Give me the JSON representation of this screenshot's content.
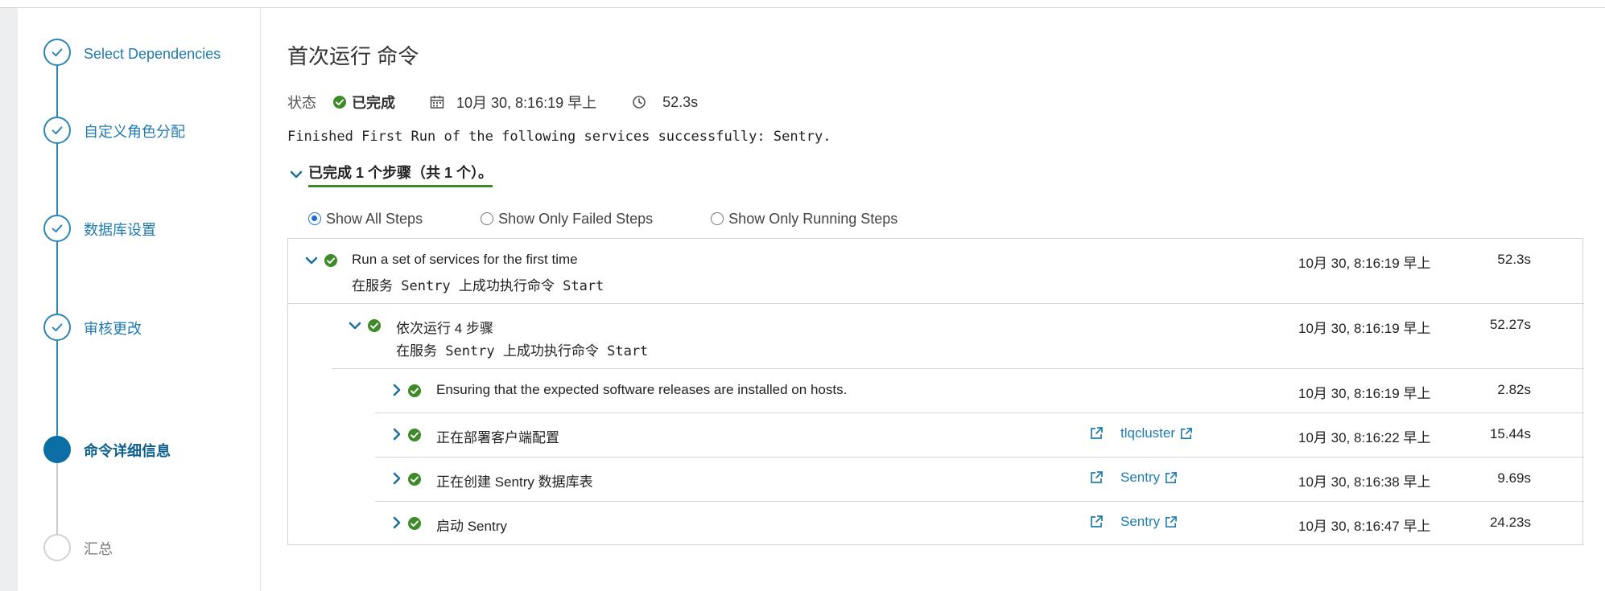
{
  "sidebar": {
    "steps": [
      {
        "label": "Select Dependencies",
        "state": "done"
      },
      {
        "label": "自定义角色分配",
        "state": "done"
      },
      {
        "label": "数据库设置",
        "state": "done"
      },
      {
        "label": "审核更改",
        "state": "done"
      },
      {
        "label": "命令详细信息",
        "state": "active"
      },
      {
        "label": "汇总",
        "state": "pending"
      }
    ]
  },
  "command": {
    "title": "首次运行 命令",
    "status_label": "状态",
    "status_value": "已完成",
    "date": "10月 30, 8:16:19 早上",
    "duration": "52.3s",
    "message": "Finished First Run of the following services successfully: Sentry.",
    "summary": "已完成 1 个步骤（共 1 个）。"
  },
  "filters": [
    {
      "label": "Show All Steps",
      "selected": true
    },
    {
      "label": "Show Only Failed Steps",
      "selected": false
    },
    {
      "label": "Show Only Running Steps",
      "selected": false
    }
  ],
  "steps": {
    "top": {
      "title": "Run a set of services for the first time",
      "subtitle": "在服务 Sentry 上成功执行命令 Start",
      "time": "10月 30, 8:16:19 早上",
      "duration": "52.3s"
    },
    "mid": {
      "title": "依次运行 4 步骤",
      "subtitle": "在服务 Sentry 上成功执行命令 Start",
      "time": "10月 30, 8:16:19 早上",
      "duration": "52.27s"
    },
    "children": [
      {
        "title": "Ensuring that the expected software releases are installed on hosts.",
        "link": "",
        "time": "10月 30, 8:16:19 早上",
        "duration": "2.82s"
      },
      {
        "title": "正在部署客户端配置",
        "link": "tlqcluster",
        "time": "10月 30, 8:16:22 早上",
        "duration": "15.44s"
      },
      {
        "title": "正在创建 Sentry 数据库表",
        "link": "Sentry",
        "time": "10月 30, 8:16:38 早上",
        "duration": "9.69s"
      },
      {
        "title": "启动 Sentry",
        "link": "Sentry",
        "time": "10月 30, 8:16:47 早上",
        "duration": "24.23s"
      }
    ]
  },
  "colors": {
    "accent": "#1f7bb0",
    "success": "#3d8b28",
    "active_step": "#0b6fa6"
  }
}
